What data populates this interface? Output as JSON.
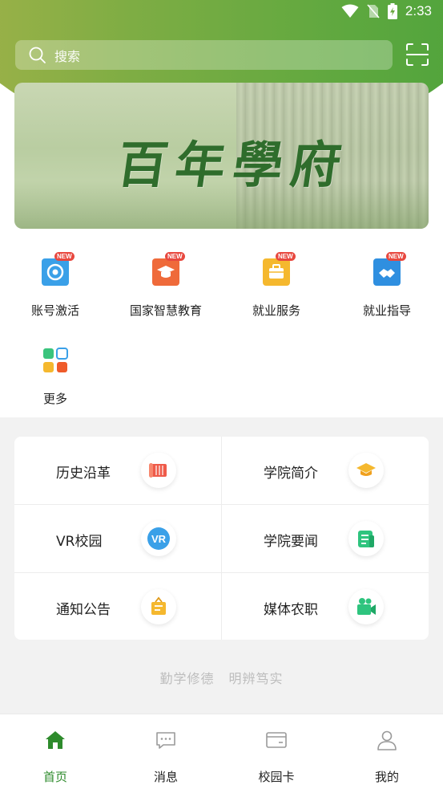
{
  "status_bar": {
    "time": "2:33"
  },
  "search": {
    "placeholder": "搜索"
  },
  "banner": {
    "calligraphy": "百年學府"
  },
  "quick_actions": [
    {
      "label": "账号激活",
      "badge": "NEW",
      "color": "#3aa0e8"
    },
    {
      "label": "国家智慧教育",
      "badge": "NEW",
      "color": "#ef6a3a"
    },
    {
      "label": "就业服务",
      "badge": "NEW",
      "color": "#f5b82e"
    },
    {
      "label": "就业指导",
      "badge": "NEW",
      "color": "#2f8fe0"
    },
    {
      "label": "更多",
      "badge": "",
      "color": "#3ac47d"
    }
  ],
  "grid_items": [
    {
      "label": "历史沿革",
      "icon": "scroll-icon",
      "color": "#ef5b4a"
    },
    {
      "label": "学院简介",
      "icon": "graduation-cap-icon",
      "color": "#f5b82e"
    },
    {
      "label": "VR校园",
      "icon": "vr-icon",
      "color": "#3aa0e8"
    },
    {
      "label": "学院要闻",
      "icon": "newspaper-icon",
      "color": "#2ec47e"
    },
    {
      "label": "通知公告",
      "icon": "notice-board-icon",
      "color": "#f5b82e"
    },
    {
      "label": "媒体农职",
      "icon": "video-camera-icon",
      "color": "#2ec47e"
    }
  ],
  "motto": {
    "part1": "勤学修德",
    "part2": "明辨笃实"
  },
  "bottom_nav": [
    {
      "label": "首页",
      "active": true
    },
    {
      "label": "消息",
      "active": false
    },
    {
      "label": "校园卡",
      "active": false
    },
    {
      "label": "我的",
      "active": false
    }
  ],
  "colors": {
    "brand_green": "#2e8b2c",
    "badge_red": "#e8483f"
  }
}
